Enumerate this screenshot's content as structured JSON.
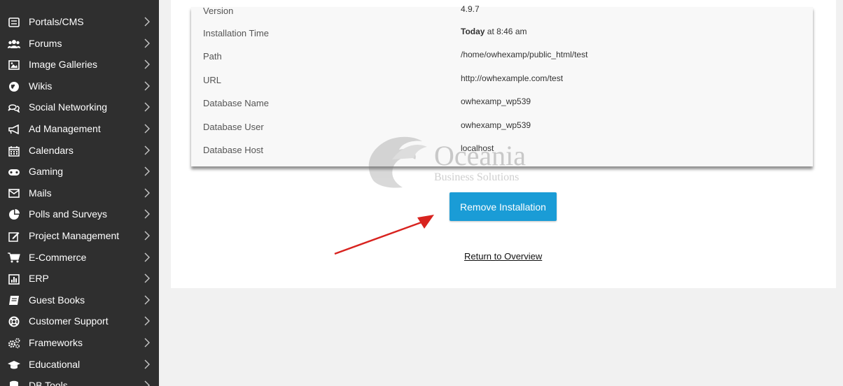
{
  "sidebar": {
    "items": [
      {
        "label": "Portals/CMS",
        "icon": "list-icon"
      },
      {
        "label": "Forums",
        "icon": "users-icon"
      },
      {
        "label": "Image Galleries",
        "icon": "image-icon"
      },
      {
        "label": "Wikis",
        "icon": "globe-icon"
      },
      {
        "label": "Social Networking",
        "icon": "chat-icon"
      },
      {
        "label": "Ad Management",
        "icon": "megaphone-icon"
      },
      {
        "label": "Calendars",
        "icon": "calendar-icon"
      },
      {
        "label": "Gaming",
        "icon": "gamepad-icon"
      },
      {
        "label": "Mails",
        "icon": "envelope-icon"
      },
      {
        "label": "Polls and Surveys",
        "icon": "pie-chart-icon"
      },
      {
        "label": "Project Management",
        "icon": "edit-icon"
      },
      {
        "label": "E-Commerce",
        "icon": "cart-icon"
      },
      {
        "label": "ERP",
        "icon": "bar-chart-icon"
      },
      {
        "label": "Guest Books",
        "icon": "book-icon"
      },
      {
        "label": "Customer Support",
        "icon": "lifebuoy-icon"
      },
      {
        "label": "Frameworks",
        "icon": "gears-icon"
      },
      {
        "label": "Educational",
        "icon": "graduation-cap-icon"
      },
      {
        "label": "DB Tools",
        "icon": "database-icon"
      }
    ]
  },
  "details": {
    "rows": [
      {
        "key": "Installation Time",
        "value_bold": "Today",
        "value": " at 8:46 am"
      },
      {
        "key": "Path",
        "value_bold": "",
        "value": "/home/owhexamp/public_html/test"
      },
      {
        "key": "URL",
        "value_bold": "",
        "value": "http://owhexample.com/test"
      },
      {
        "key": "Database Name",
        "value_bold": "",
        "value": "owhexamp_wp539"
      },
      {
        "key": "Database User",
        "value_bold": "",
        "value": "owhexamp_wp539"
      },
      {
        "key": "Database Host",
        "value_bold": "",
        "value": "localhost"
      }
    ],
    "partial_top": {
      "key": "Version",
      "value": "4.9.7"
    }
  },
  "watermark": {
    "title": "Oceania",
    "subtitle": "Business Solutions"
  },
  "actions": {
    "remove_label": "Remove Installation",
    "return_label": "Return to Overview"
  },
  "colors": {
    "button": "#1a9cd6",
    "sidebar": "#2f2f2f",
    "arrow": "#d8231f"
  }
}
